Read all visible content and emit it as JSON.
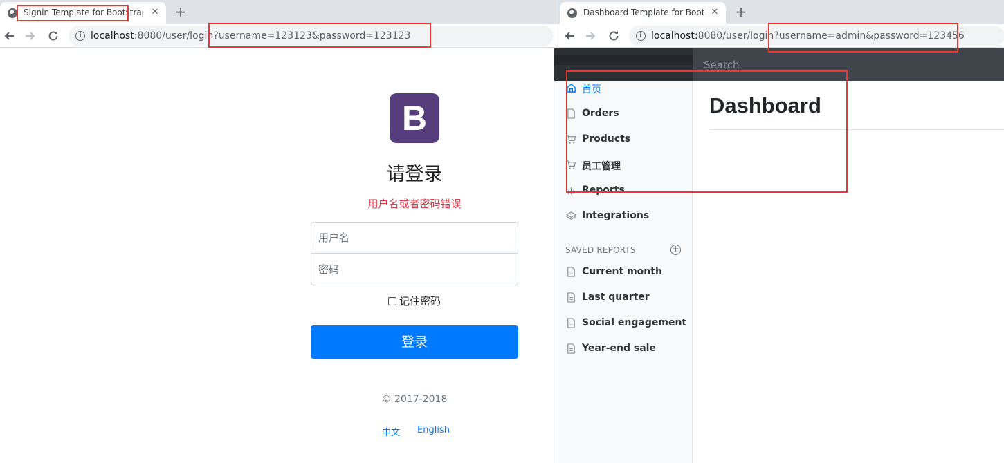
{
  "left_window": {
    "tab": {
      "title": "Signin Template for Bootstrap",
      "close": "✕"
    },
    "new_tab": "+",
    "url": {
      "host": "localhost:",
      "path": "8080/user/login",
      "query": "?username=123123&password=123123"
    },
    "page": {
      "logo_letter": "B",
      "title": "请登录",
      "error": "用户名或者密码错误",
      "username_placeholder": "用户名",
      "password_placeholder": "密码",
      "remember_label": "记住密码",
      "login_button": "登录",
      "copyright": "© 2017-2018",
      "lang_zh": "中文",
      "lang_en": "English"
    }
  },
  "right_window": {
    "tab": {
      "title": "Dashboard Template for Bootstrap",
      "close": "✕"
    },
    "new_tab": "+",
    "url": {
      "host": "localhost:",
      "path": "8080/user/login",
      "query": "?username=admin&password=123456"
    },
    "dashboard": {
      "search_placeholder": "Search",
      "nav": [
        {
          "label": "首页",
          "icon": "home-icon",
          "active": true
        },
        {
          "label": "Orders",
          "icon": "file-icon",
          "active": false
        },
        {
          "label": "Products",
          "icon": "cart-icon",
          "active": false
        },
        {
          "label": "员工管理",
          "icon": "cart-icon",
          "active": false
        },
        {
          "label": "Reports",
          "icon": "bar-chart-icon",
          "active": false
        },
        {
          "label": "Integrations",
          "icon": "layers-icon",
          "active": false
        }
      ],
      "saved_reports_header": "SAVED REPORTS",
      "saved_reports": [
        {
          "label": "Current month",
          "icon": "file-text-icon"
        },
        {
          "label": "Last quarter",
          "icon": "file-text-icon"
        },
        {
          "label": "Social engagement",
          "icon": "file-text-icon"
        },
        {
          "label": "Year-end sale",
          "icon": "file-text-icon"
        }
      ],
      "heading": "Dashboard"
    }
  },
  "colors": {
    "highlight_box": "#e53935",
    "bootstrap_purple": "#563d7c",
    "primary_blue": "#007bff",
    "error_red": "#dc3545"
  }
}
